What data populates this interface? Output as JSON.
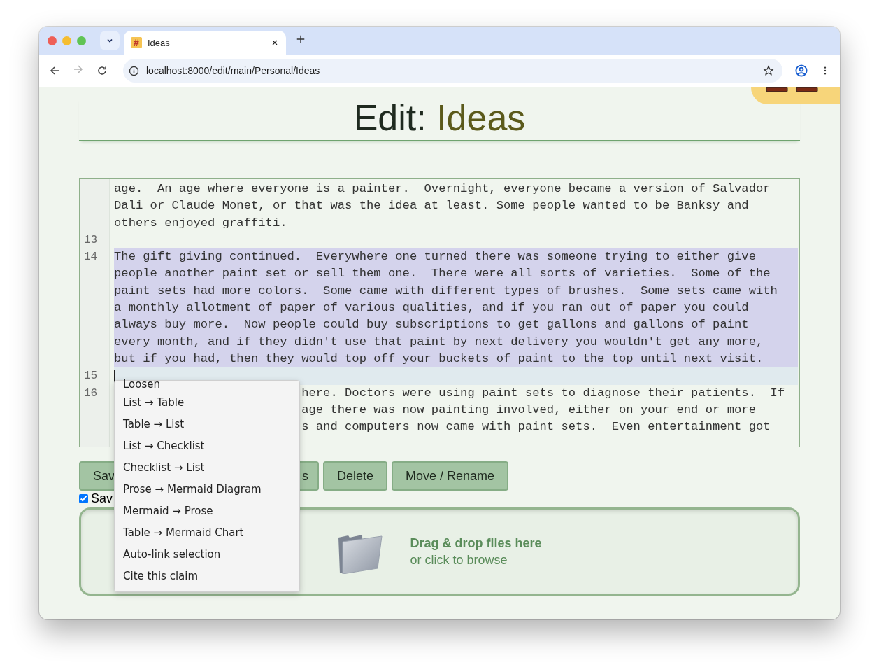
{
  "browser": {
    "tabs": [
      {
        "favicon": "#",
        "title": "Ideas",
        "selected": true
      }
    ],
    "forward_disabled": true,
    "url": "localhost:8000/edit/main/Personal/Ideas"
  },
  "heading": {
    "prefix": "Edit:",
    "name": "Ideas"
  },
  "editor": {
    "lines": [
      {
        "selected": false,
        "current": false,
        "partly_hidden": false,
        "rows": [
          "age.  An age where everyone is a painter.  Overnight, everyone became a version of Salvador",
          "Dali or Claude Monet, or that was the idea at least. Some people wanted to be Banksy and",
          "others enjoyed graffiti."
        ]
      },
      {
        "number": "13",
        "selected": false,
        "current": false,
        "partly_hidden": false,
        "rows": [
          ""
        ]
      },
      {
        "number": "14",
        "selected": true,
        "current": false,
        "partly_hidden": false,
        "rows": [
          "The gift giving continued.  Everywhere one turned there was someone trying to either give",
          "people another paint set or sell them one.  There were all sorts of varieties.  Some of the",
          "paint sets had more colors.  Some came with different types of brushes.  Some sets came with",
          "a monthly allotment of paper of various qualities, and if you ran out of paper you could",
          "always buy more.  Now people could buy subscriptions to get gallons and gallons of paint",
          "every month, and if they didn't use that paint by next delivery you wouldn't get any more,",
          "but if you had, then they would top off your buckets of paint to the top until next visit."
        ]
      },
      {
        "number": "15",
        "selected": false,
        "current": true,
        "partly_hidden": false,
        "rows": [
          ""
        ]
      },
      {
        "number": "16",
        "selected": false,
        "current": false,
        "partly_hidden": true,
        "rows": [
          "here. Doctors were using paint sets to diagnose their patients.  If",
          "age there was now painting involved, either on your end or more",
          "s and computers now came with paint sets.  Even entertainment got"
        ]
      }
    ]
  },
  "buttons": [
    "Sav",
    "s",
    "Delete",
    "Move / Rename"
  ],
  "autosave": {
    "label": "Sav",
    "checked": true
  },
  "dropzone": {
    "title": "Drag & drop files here",
    "subtitle": "or click to browse"
  },
  "context_menu": [
    "Loosen",
    "List → Table",
    "Table → List",
    "List → Checklist",
    "Checklist → List",
    "Prose → Mermaid Diagram",
    "Mermaid → Prose",
    "Table → Mermaid Chart",
    "Auto-link selection",
    "Cite this claim"
  ]
}
